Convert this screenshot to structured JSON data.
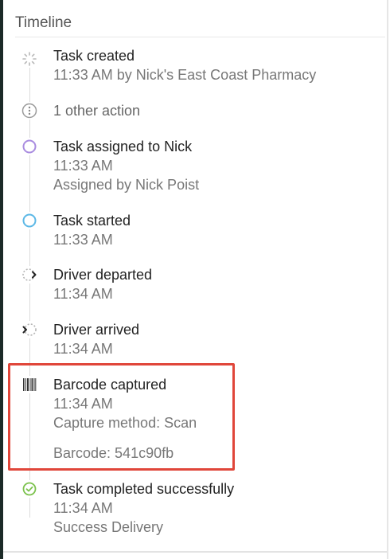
{
  "panel": {
    "title": "Timeline"
  },
  "events": [
    {
      "icon": "spinner-icon",
      "title": "Task created",
      "lines": [
        "11:33 AM by Nick's East Coast Pharmacy"
      ]
    },
    {
      "icon": "more-dots-icon",
      "title": "1 other action",
      "lines": []
    },
    {
      "icon": "purple-circle-icon",
      "title": "Task assigned to Nick",
      "lines": [
        "11:33 AM",
        "Assigned by Nick Poist"
      ]
    },
    {
      "icon": "blue-circle-icon",
      "title": "Task started",
      "lines": [
        "11:33 AM"
      ]
    },
    {
      "icon": "departed-icon",
      "title": "Driver departed",
      "lines": [
        "11:34 AM"
      ]
    },
    {
      "icon": "arrived-icon",
      "title": "Driver arrived",
      "lines": [
        "11:34 AM"
      ]
    },
    {
      "icon": "barcode-icon",
      "title": "Barcode captured",
      "lines": [
        "11:34 AM",
        "Capture method: Scan",
        "Barcode: 541c90fb"
      ]
    },
    {
      "icon": "check-circle-icon",
      "title": "Task completed successfully",
      "lines": [
        "11:34 AM",
        "Success Delivery"
      ]
    }
  ],
  "colors": {
    "highlight": "#e0463a",
    "assigned": "#a98ce0",
    "started": "#5cb8e6",
    "completed": "#7cc24d"
  }
}
